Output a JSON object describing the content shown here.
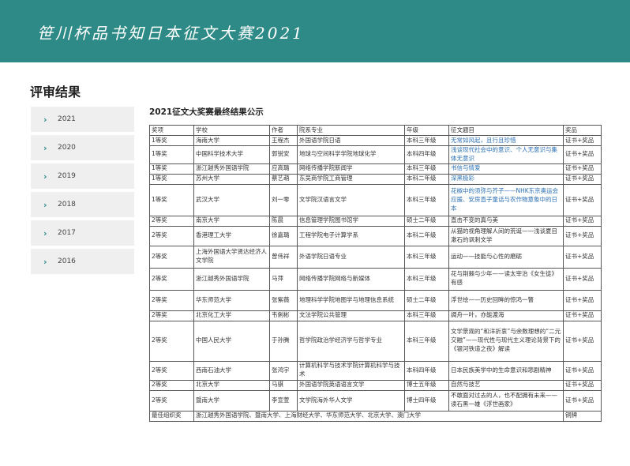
{
  "banner": {
    "title": "笹川杯品书知日本征文大赛2021"
  },
  "page": {
    "section_title": "评审结果",
    "table_title": "2021征文大奖赛最终结果公示"
  },
  "sidebar": {
    "years": [
      {
        "label": "2021"
      },
      {
        "label": "2020"
      },
      {
        "label": "2019"
      },
      {
        "label": "2018"
      },
      {
        "label": "2017"
      },
      {
        "label": "2016"
      }
    ]
  },
  "table": {
    "headers": [
      "奖项",
      "学校",
      "作者",
      "院系专业",
      "年级",
      "征文题目",
      "奖品"
    ],
    "rows": [
      {
        "award": "1等奖",
        "school": "海南大学",
        "author": "王程杰",
        "dept": "外国语学院日语",
        "grade": "本科三年级",
        "title": "无常如风起，且行且珍惜",
        "link": true,
        "prize": "证书+奖品"
      },
      {
        "award": "1等奖",
        "school": "中国科学技术大学",
        "author": "郭锐安",
        "dept": "地球与空间科学学院地球化学",
        "grade": "本科四年级",
        "title": "浅谈现代社会中的意识、个人无意识与集体无意识",
        "link": true,
        "prize": "证书+奖品"
      },
      {
        "award": "1等奖",
        "school": "浙江越秀外国语学院",
        "author": "应高璐",
        "dept": "网络传播学院新闻学",
        "grade": "本科三年级",
        "title": "书信与情爱",
        "link": true,
        "prize": "证书+奖品"
      },
      {
        "award": "1等奖",
        "school": "苏州大学",
        "author": "蔡艺萌",
        "dept": "东吴商学院工商管理",
        "grade": "本科二年级",
        "title": "深黑极彩",
        "link": true,
        "prize": "证书+奖品"
      },
      {
        "award": "1等奖",
        "school": "武汉大学",
        "author": "刘一零",
        "dept": "文学院汉语言文学",
        "grade": "本科三年级",
        "title": "花椒中的须弥与芥子——NHK东京奥运会应援、安房直子童话与农作物意象中的日本",
        "link": true,
        "prize": "证书+奖品"
      },
      {
        "award": "2等奖",
        "school": "南京大学",
        "author": "陈晨",
        "dept": "信息管理学院图书馆学",
        "grade": "硕士二年级",
        "title": "直击不变的真与美",
        "link": false,
        "prize": "证书+奖品"
      },
      {
        "award": "2等奖",
        "school": "香港理工大学",
        "author": "徐嘉璐",
        "dept": "工程学院电子计算学系",
        "grade": "本科二年级",
        "title": "从猫的视角理解人间的荒诞——浅谈夏目漱石的讽刺文学",
        "link": false,
        "prize": "证书+奖品"
      },
      {
        "award": "2等奖",
        "school": "上海外国语大学贤达经济人文学院",
        "author": "曾伟祥",
        "dept": "外语学院日语专业",
        "grade": "本科三年级",
        "title": "运动——技能与心性的磨砺",
        "link": false,
        "prize": "证书+奖品"
      },
      {
        "award": "2等奖",
        "school": "浙江越秀外国语学院",
        "author": "马萍",
        "dept": "网络传播学院网络与新媒体",
        "grade": "本科三年级",
        "title": "花与荆棘与少年——读太宰治《女生徒》有感",
        "link": false,
        "prize": "证书+奖品"
      },
      {
        "award": "2等奖",
        "school": "华东师范大学",
        "author": "张紫薇",
        "dept": "地理科学学院地图学与地理信息系统",
        "grade": "硕士二年级",
        "title": "浮世绘——历史回眸的惊鸿一瞥",
        "link": false,
        "prize": "证书+奖品"
      },
      {
        "award": "2等奖",
        "school": "北京化工大学",
        "author": "韦俐彬",
        "dept": "文法学院公共管理",
        "grade": "本科三年级",
        "title": "绸舟一叶，亦能渡海",
        "link": false,
        "prize": "证书+奖品"
      },
      {
        "award": "2等奖",
        "school": "中国人民大学",
        "author": "于孙腾",
        "dept": "哲学院政治学经济学与哲学专业",
        "grade": "本科三年级",
        "title": "文学景观的“和洋折衷”与余数理想的“二元交融”——现代性与现代主义理论背景下的《银河铁道之夜》解读",
        "link": false,
        "prize": "证书+奖品"
      },
      {
        "award": "2等奖",
        "school": "西南石油大学",
        "author": "张鸿宇",
        "dept": "计算机科学与技术学院计算机科学与技术",
        "grade": "本科四年级",
        "title": "日本民族美学中的生命意识和悲剧精神",
        "link": false,
        "prize": "证书+奖品"
      },
      {
        "award": "2等奖",
        "school": "北京大学",
        "author": "马骐",
        "dept": "外国语学院英语语言文学",
        "grade": "博士五年级",
        "title": "自然与技艺",
        "link": false,
        "prize": "证书+奖品"
      },
      {
        "award": "2等奖",
        "school": "暨南大学",
        "author": "李宣萱",
        "dept": "文学院海外华人文学",
        "grade": "博士四年级",
        "title": "不敢面对过去的人，也不配拥有未来——读石黑一雄《浮世画家》",
        "link": false,
        "prize": "证书+奖品"
      }
    ],
    "org_award": {
      "label": "最佳组织奖",
      "schools": "浙江越秀外国语学院、暨南大学、上海财经大学、华东师范大学、北京大学、澳门大学",
      "prize": "铜牌"
    }
  }
}
